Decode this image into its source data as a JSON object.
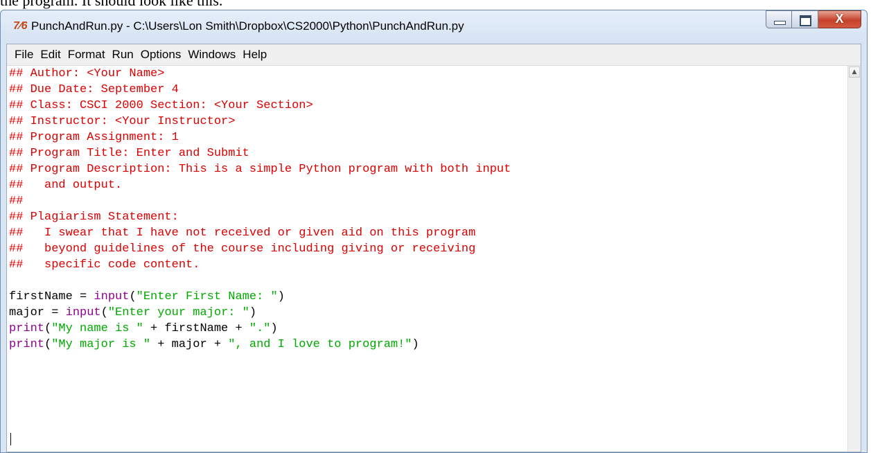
{
  "page_text": "the program. It should look like this.",
  "window": {
    "title": "PunchAndRun.py - C:\\Users\\Lon Smith\\Dropbox\\CS2000\\Python\\PunchAndRun.py",
    "app_icon_text": "7⁄6",
    "minimize_icon": "minimize-icon",
    "maximize_icon": "maximize-icon",
    "close_icon": "close-icon",
    "close_glyph": "X"
  },
  "menu": {
    "items": [
      "File",
      "Edit",
      "Format",
      "Run",
      "Options",
      "Windows",
      "Help"
    ]
  },
  "editor": {
    "lines": [
      "## Author: <Your Name>",
      "## Due Date: September 4",
      "## Class: CSCI 2000 Section: <Your Section>",
      "## Instructor: <Your Instructor>",
      "## Program Assignment: 1",
      "## Program Title: Enter and Submit",
      "## Program Description: This is a simple Python program with both input",
      "##   and output.",
      "##",
      "## Plagiarism Statement:",
      "##   I swear that I have not received or given aid on this program",
      "##   beyond guidelines of the course including giving or receiving",
      "##   specific code content.",
      "",
      "firstName = input(\"Enter First Name: \")",
      "major = input(\"Enter your major: \")",
      "print(\"My name is \" + firstName + \".\")",
      "print(\"My major is \" + major + \", and I love to program!\")"
    ]
  },
  "colors": {
    "comment": "#dd0000",
    "builtin": "#900090",
    "string": "#00aa00",
    "close_button": "#c7412a"
  }
}
